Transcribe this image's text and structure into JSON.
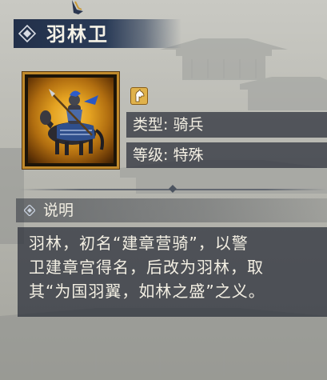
{
  "unit": {
    "name": "羽林卫",
    "portrait": "armored-cavalry-portrait",
    "type_icon": "horse-head-icon",
    "attributes": [
      {
        "text": "类型: 骑兵"
      },
      {
        "text": "等级: 特殊"
      }
    ]
  },
  "description": {
    "header": "说明",
    "text": "羽林，初名“建章营骑”，以警\n卫建章宫得名，后改为羽林，取\n其“为国羽翼，如林之盛”之义。"
  },
  "colors": {
    "title_banner": "#2a3b57",
    "portrait_border": "#c08a2c",
    "text": "#f3efe3",
    "badge": "#e0b24c"
  }
}
